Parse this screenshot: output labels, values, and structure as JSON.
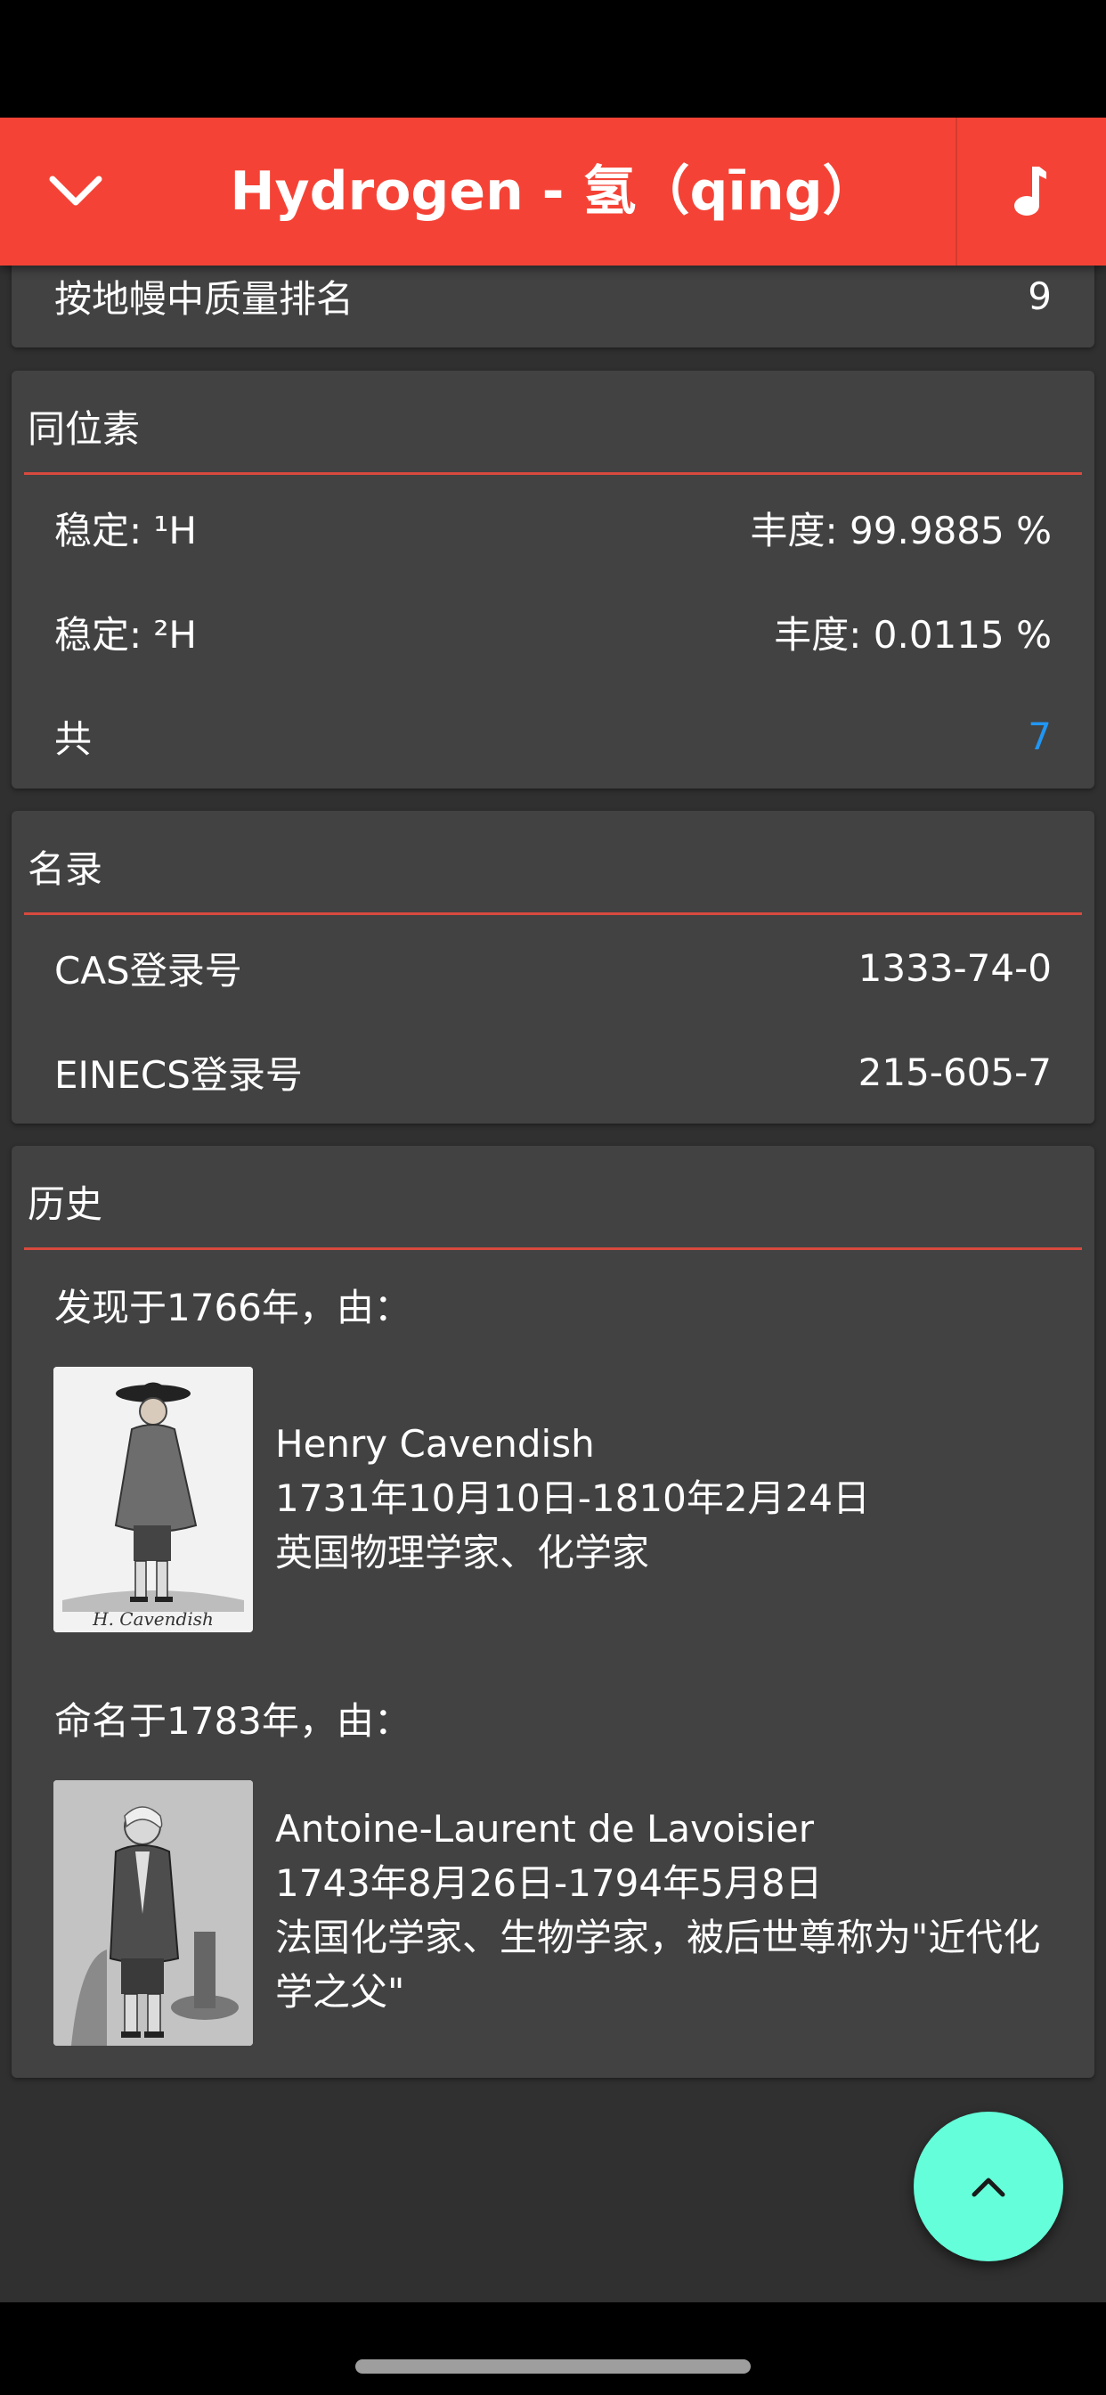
{
  "app_bar": {
    "title": "Hydrogen - 氢（qīng）"
  },
  "top_card": {
    "label": "按地幔中质量排名",
    "value": "9"
  },
  "isotopes": {
    "title": "同位素",
    "rows": [
      {
        "label": "稳定: ¹H",
        "value": "丰度: 99.9885 %"
      },
      {
        "label": "稳定: ²H",
        "value": "丰度: 0.0115 %"
      }
    ],
    "total_label": "共",
    "total_value": "7"
  },
  "registry": {
    "title": "名录",
    "rows": [
      {
        "label": "CAS登录号",
        "value": "1333-74-0"
      },
      {
        "label": "EINECS登录号",
        "value": "215-605-7"
      }
    ]
  },
  "history": {
    "title": "历史",
    "discovered_label": "发现于1766年，由：",
    "discoverer": {
      "name": "Henry Cavendish",
      "dates": "1731年10月10日-1810年2月24日",
      "description": "英国物理学家、化学家",
      "signature": "H. Cavendish"
    },
    "named_label": "命名于1783年，由：",
    "namer": {
      "name": "Antoine-Laurent de Lavoisier",
      "dates": "1743年8月26日-1794年5月8日",
      "description": "法国化学家、生物学家，被后世尊称为\"近代化学之父\""
    }
  },
  "colors": {
    "accent": "#f44336",
    "fab": "#64ffda",
    "link": "#2196f3",
    "card": "#424242",
    "background": "#303030"
  }
}
